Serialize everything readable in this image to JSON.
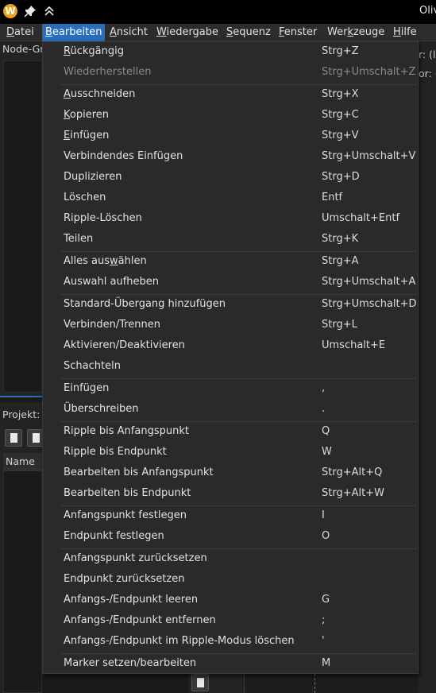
{
  "window": {
    "title": "Oliv",
    "app_icon_letter": "W"
  },
  "menubar": [
    {
      "label": "Datei",
      "mnemonic": "D"
    },
    {
      "label": "Bearbeiten",
      "mnemonic": "B"
    },
    {
      "label": "Ansicht",
      "mnemonic": "A"
    },
    {
      "label": "Wiedergabe",
      "mnemonic": "W"
    },
    {
      "label": "Sequenz",
      "mnemonic": "S"
    },
    {
      "label": "Fenster",
      "mnemonic": "F"
    },
    {
      "label": "Werkzeuge",
      "mnemonic": "k"
    },
    {
      "label": "Hilfe",
      "mnemonic": "H"
    }
  ],
  "background": {
    "node_panel_title": "Node-Gr",
    "project_panel_title": "Projekt:",
    "project_column_name": "Name",
    "right_label_1": "r: (le",
    "right_label_2": "or: ("
  },
  "edit_menu": [
    {
      "label": "Rückgängig",
      "shortcut": "Strg+Z",
      "underline": "R"
    },
    {
      "label": "Wiederherstellen",
      "shortcut": "Strg+Umschalt+Z",
      "disabled": true
    },
    {
      "separator": true
    },
    {
      "label": "Ausschneiden",
      "shortcut": "Strg+X",
      "underline": "A"
    },
    {
      "label": "Kopieren",
      "shortcut": "Strg+C",
      "underline": "K"
    },
    {
      "label": "Einfügen",
      "shortcut": "Strg+V",
      "underline": "E"
    },
    {
      "label": "Verbindendes Einfügen",
      "shortcut": "Strg+Umschalt+V"
    },
    {
      "label": "Duplizieren",
      "shortcut": "Strg+D"
    },
    {
      "label": "Löschen",
      "shortcut": "Entf"
    },
    {
      "label": "Ripple-Löschen",
      "shortcut": "Umschalt+Entf"
    },
    {
      "label": "Teilen",
      "shortcut": "Strg+K"
    },
    {
      "separator": true
    },
    {
      "label": "Alles auswählen",
      "shortcut": "Strg+A",
      "underline": "w"
    },
    {
      "label": "Auswahl aufheben",
      "shortcut": "Strg+Umschalt+A"
    },
    {
      "separator": true
    },
    {
      "label": "Standard-Übergang hinzufügen",
      "shortcut": "Strg+Umschalt+D"
    },
    {
      "label": "Verbinden/Trennen",
      "shortcut": "Strg+L"
    },
    {
      "label": "Aktivieren/Deaktivieren",
      "shortcut": "Umschalt+E"
    },
    {
      "label": "Schachteln",
      "shortcut": ""
    },
    {
      "separator": true
    },
    {
      "label": "Einfügen",
      "shortcut": ","
    },
    {
      "label": "Überschreiben",
      "shortcut": "."
    },
    {
      "separator": true
    },
    {
      "label": "Ripple bis Anfangspunkt",
      "shortcut": "Q"
    },
    {
      "label": "Ripple bis Endpunkt",
      "shortcut": "W"
    },
    {
      "label": "Bearbeiten bis Anfangspunkt",
      "shortcut": "Strg+Alt+Q"
    },
    {
      "label": "Bearbeiten bis Endpunkt",
      "shortcut": "Strg+Alt+W"
    },
    {
      "separator": true
    },
    {
      "label": "Anfangspunkt festlegen",
      "shortcut": "I"
    },
    {
      "label": "Endpunkt festlegen",
      "shortcut": "O"
    },
    {
      "separator": true
    },
    {
      "label": "Anfangspunkt zurücksetzen",
      "shortcut": ""
    },
    {
      "label": "Endpunkt zurücksetzen",
      "shortcut": ""
    },
    {
      "label": "Anfangs-/Endpunkt leeren",
      "shortcut": "G"
    },
    {
      "label": "Anfangs-/Endpunkt entfernen",
      "shortcut": ";"
    },
    {
      "label": "Anfangs-/Endpunkt im Ripple-Modus löschen",
      "shortcut": "'"
    },
    {
      "separator": true
    },
    {
      "label": "Marker setzen/bearbeiten",
      "shortcut": "M"
    }
  ],
  "colors": {
    "menu_highlight": "#2d6db5",
    "menu_bg": "#2a2a2a",
    "app_icon": "#e8a020"
  }
}
